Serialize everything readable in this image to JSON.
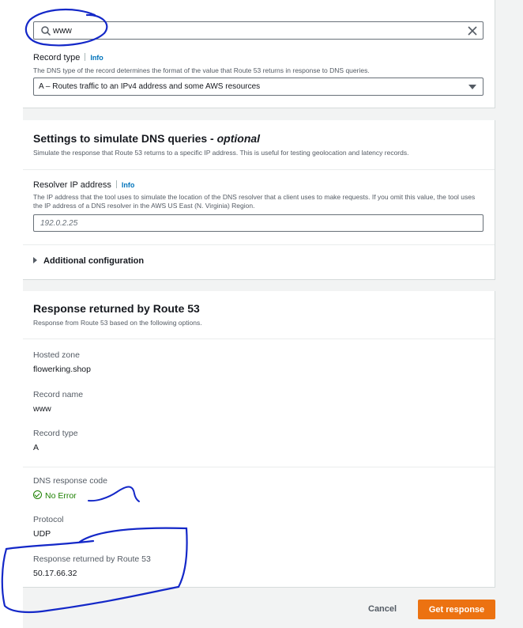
{
  "record_name_search": {
    "value": "www"
  },
  "record_type": {
    "label": "Record type",
    "info": "Info",
    "description": "The DNS type of the record determines the format of the value that Route 53 returns in response to DNS queries.",
    "selected": "A – Routes traffic to an IPv4 address and some AWS resources"
  },
  "simulate": {
    "title": "Settings to simulate DNS queries - ",
    "title_optional": "optional",
    "description": "Simulate the response that Route 53 returns to a specific IP address. This is useful for testing geolocation and latency records.",
    "resolver_label": "Resolver IP address",
    "resolver_info": "Info",
    "resolver_description": "The IP address that the tool uses to simulate the location of the DNS resolver that a client uses to make requests. If you omit this value, the tool uses the IP address of a DNS resolver in the AWS US East (N. Virginia) Region.",
    "resolver_placeholder": "192.0.2.25",
    "additional_config": "Additional configuration"
  },
  "response": {
    "title": "Response returned by Route 53",
    "description": "Response from Route 53 based on the following options.",
    "hosted_zone_label": "Hosted zone",
    "hosted_zone_value": "flowerking.shop",
    "record_name_label": "Record name",
    "record_name_value": "www",
    "record_type_label": "Record type",
    "record_type_value": "A",
    "dns_code_label": "DNS response code",
    "dns_code_value": "No Error",
    "protocol_label": "Protocol",
    "protocol_value": "UDP",
    "returned_label": "Response returned by Route 53",
    "returned_value": "50.17.66.32"
  },
  "actions": {
    "cancel": "Cancel",
    "get_response": "Get response"
  },
  "colors": {
    "accent_link": "#0073bb",
    "primary_button": "#ec7211",
    "success": "#1d8102",
    "annotation_ink": "#1428c8"
  }
}
